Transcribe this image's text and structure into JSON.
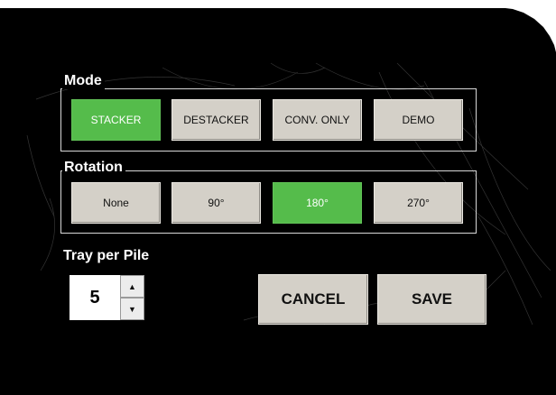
{
  "mode": {
    "title": "Mode",
    "options": [
      {
        "label": "STACKER",
        "active": true
      },
      {
        "label": "DESTACKER",
        "active": false
      },
      {
        "label": "CONV. ONLY",
        "active": false
      },
      {
        "label": "DEMO",
        "active": false
      }
    ]
  },
  "rotation": {
    "title": "Rotation",
    "options": [
      {
        "label": "None",
        "active": false
      },
      {
        "label": "90°",
        "active": false
      },
      {
        "label": "180°",
        "active": true
      },
      {
        "label": "270°",
        "active": false
      }
    ]
  },
  "tray_per_pile": {
    "label": "Tray per Pile",
    "value": "5",
    "up_icon": "triangle-up",
    "down_icon": "triangle-down"
  },
  "actions": {
    "cancel_label": "CANCEL",
    "save_label": "SAVE"
  },
  "colors": {
    "background": "#000000",
    "button": "#d4d0c8",
    "active_button": "#55bc4b",
    "frame": "#d8d8d8"
  }
}
